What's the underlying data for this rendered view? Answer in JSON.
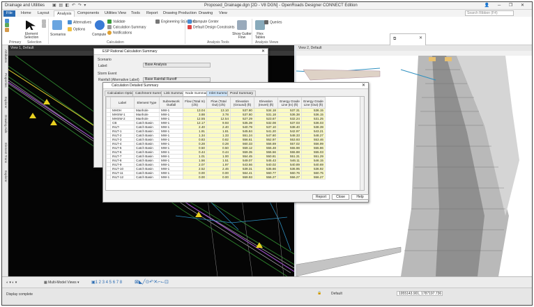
{
  "titlebar": {
    "workflow": "Drainage and Utilities",
    "title": "Proposed_Drainage.dgn [2D - V8 DGN] - OpenRoads Designer CONNECT Edition"
  },
  "tabs": [
    "File",
    "Home",
    "Layout",
    "Analysis",
    "Components",
    "Utilities View",
    "Tools",
    "Report",
    "Drawing Production",
    "Drawing",
    "View"
  ],
  "search_placeholder": "Search Ribbon (F4)",
  "ribbon": {
    "element_selection": "Element Selection",
    "scenarios": "Scenarios",
    "alternatives": "Alternatives",
    "options": "Options",
    "compute": "Compute",
    "validate": "Validate",
    "calc_summary": "Calculation Summary",
    "notifications": "Notifications",
    "eng_standards": "Engineering Standards",
    "compute_center": "Compute Center",
    "default_constraints": "Default Design Constraints",
    "show_gutter": "Show Gutter Flow",
    "flex_tables": "Flex Tables",
    "queries": "Queries",
    "groups": {
      "primary": "Primary",
      "selection": "Selection",
      "calculation": "Calculation",
      "analysis_tools": "Analysis Tools",
      "analysis_views": "Analysis Views"
    }
  },
  "rail": [
    "Attributes",
    "Properties",
    "Explorer",
    "Drawing Aids",
    "Element Trans",
    "Explorer"
  ],
  "view1": {
    "title": "View 1, Default"
  },
  "view2": {
    "title": "View 2, Default"
  },
  "back_dialog": {
    "title": "ESP Rational Calculation Summary",
    "scenario_header": "Scenario",
    "label_label": "Label:",
    "label_value": "Base Analysis",
    "storm_event": "Storm Event",
    "rainfall_label": "Rainfall (Alternative Label)",
    "rainfall_value": "Base Rainfall Runoff"
  },
  "dialog": {
    "title": "Calculation Detailed Summary",
    "tabs": [
      "Calculation Options",
      "Catchment Summary",
      "Link Summary",
      "Node Summary",
      "Inlet Summary",
      "Pond Summary"
    ],
    "columns": [
      "Label",
      "Element Type",
      "Subnetwork Outfall",
      "Flow (Total In) (cfs)",
      "Flow (Total Out) (cfs)",
      "Elevation (Ground) (ft)",
      "Elevation (Invert) (ft)",
      "Energy Grade Line (In) (ft)",
      "Energy Grade Line (Out) (ft)"
    ],
    "rows": [
      [
        "MH0H",
        "Manhole",
        "MW-1",
        "13.04",
        "13.10",
        "537.80",
        "534.18",
        "537.31",
        "536.15"
      ],
      [
        "MHSW-1",
        "Manhole",
        "MW-1",
        "3.88",
        "3.78",
        "537.80",
        "531.18",
        "536.38",
        "536.15"
      ],
      [
        "MHSW-2",
        "Manhole",
        "MW-1",
        "12.55",
        "12.54",
        "527.29",
        "523.67",
        "532.24",
        "531.25"
      ],
      [
        "CB",
        "Catch Basin",
        "MW-1",
        "12.17",
        "9.93",
        "535.39",
        "532.08",
        "537.03",
        "536.03"
      ],
      [
        "INLT-",
        "Catch Basin",
        "MW-1",
        "2.40",
        "2.40",
        "540.79",
        "537.10",
        "538.40",
        "538.39"
      ],
      [
        "INLT-1",
        "Catch Basin",
        "MW-1",
        "1.91",
        "1.81",
        "545.84",
        "541.20",
        "542.97",
        "543.21"
      ],
      [
        "INLT-2",
        "Catch Basin",
        "MW-1",
        "1.34",
        "1.33",
        "551.24",
        "547.60",
        "548.33",
        "548.27"
      ],
      [
        "INLT-3",
        "Catch Basin",
        "MW-1",
        "0.83",
        "0.82",
        "556.61",
        "552.97",
        "553.93",
        "553.46"
      ],
      [
        "INLT-4",
        "Catch Basin",
        "MW-1",
        "0.28",
        "0.28",
        "560.33",
        "556.69",
        "557.02",
        "556.99"
      ],
      [
        "INLT-5",
        "Catch Basin",
        "MW-1",
        "0.50",
        "0.50",
        "559.12",
        "555.48",
        "555.98",
        "555.86"
      ],
      [
        "INLT-6",
        "Catch Basin",
        "MW-1",
        "0.44",
        "0.44",
        "559.35",
        "555.56",
        "555.88",
        "555.03"
      ],
      [
        "INLT-7",
        "Catch Basin",
        "MW-1",
        "1.01",
        "1.00",
        "554.45",
        "550.81",
        "551.31",
        "551.29"
      ],
      [
        "INLT-8",
        "Catch Basin",
        "MW-1",
        "1.56",
        "1.51",
        "549.07",
        "545.43",
        "546.11",
        "546.15"
      ],
      [
        "INLT-9",
        "Catch Basin",
        "MW-1",
        "2.07",
        "1.97",
        "543.66",
        "540.02",
        "540.89",
        "540.69"
      ],
      [
        "INLT-10",
        "Catch Basin",
        "MW-1",
        "2.52",
        "2.46",
        "539.31",
        "535.66",
        "536.95",
        "536.92"
      ],
      [
        "INLT-11",
        "Catch Basin",
        "MW-1",
        "0.00",
        "0.00",
        "564.41",
        "560.77",
        "560.76",
        "560.75"
      ],
      [
        "INLT-12",
        "Catch Basin",
        "MW-1",
        "0.00",
        "0.00",
        "559.93",
        "556.27",
        "556.27",
        "556.27"
      ]
    ],
    "buttons": [
      "Report",
      "Close",
      "Help"
    ]
  },
  "bottom": {
    "multi_model": "Multi-Model Views"
  },
  "status": {
    "message": "Display complete",
    "level": "Default",
    "coordinates": "1955143.901, 1787197.736"
  }
}
